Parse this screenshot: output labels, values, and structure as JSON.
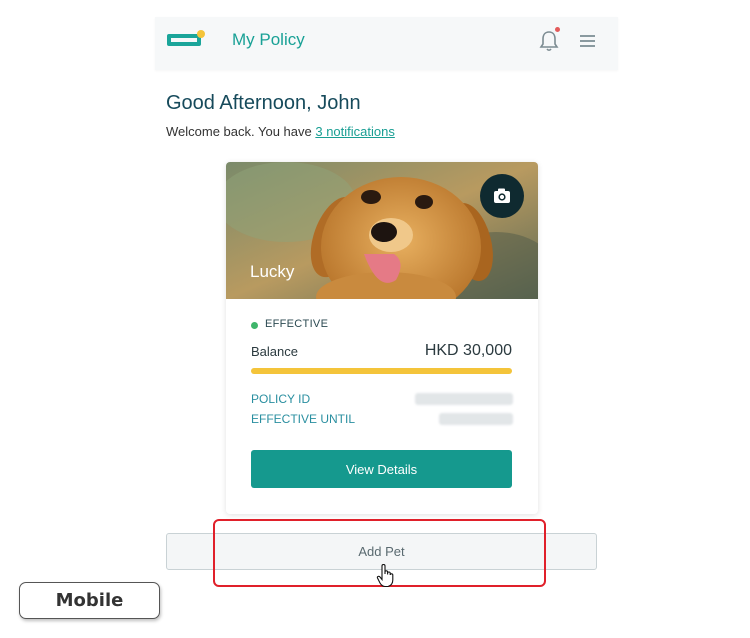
{
  "header": {
    "title": "My Policy",
    "logo_icon": "policy-card-logo",
    "notification_icon": "bell-icon",
    "menu_icon": "hamburger-menu-icon"
  },
  "greeting": {
    "title": "Good Afternoon, John",
    "welcome_prefix": "Welcome back. You have ",
    "notifications_link": "3 notifications"
  },
  "policy_card": {
    "pet_name": "Lucky",
    "camera_icon": "camera-icon",
    "status": "EFFECTIVE",
    "balance_label": "Balance",
    "balance_value": "HKD 30,000",
    "balance_fraction": 1.0,
    "policy_id_label": "POLICY ID",
    "effective_until_label": "EFFECTIVE UNTIL",
    "view_details_label": "View Details"
  },
  "add_pet_label": "Add Pet",
  "annotation": {
    "label": "Mobile"
  },
  "colors": {
    "brand_teal": "#19a196",
    "status_green": "#3fb56b",
    "balance_yellow": "#f4c43a",
    "highlight_red": "#e0202a"
  }
}
